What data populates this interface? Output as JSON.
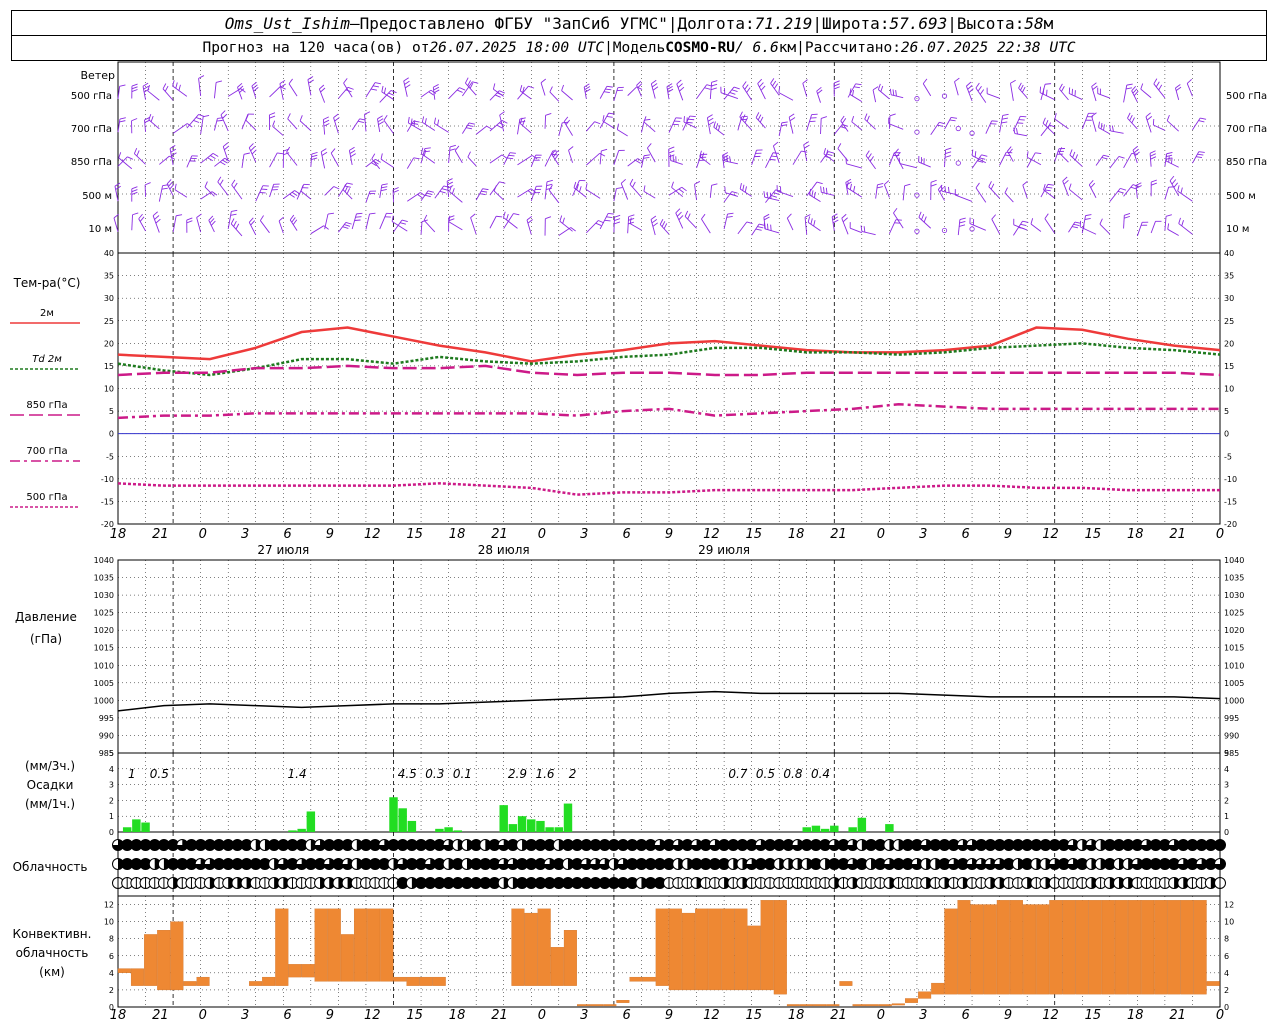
{
  "header": {
    "station": "Oms_Ust_Ishim",
    "dash": " – ",
    "provider": "Предоставлено ФГБУ \"ЗапСиб УГМС\"",
    "sep": " | ",
    "lon_label": "Долгота: ",
    "lon_value": "71.219",
    "lat_label": "Широта: ",
    "lat_value": "57.693",
    "alt_label": "Высота: ",
    "alt_value": "58",
    "alt_unit": "м",
    "forecast_label": "Прогноз на 120 часа(ов) от ",
    "forecast_start": "26.07.2025 18:00 UTC",
    "model_label": "Модель ",
    "model_name": "COSMO-RU",
    "model_res": " / 6.6",
    "model_res_unit": "км",
    "computed_label": "Рассчитано: ",
    "computed_value": "26.07.2025 22:38 UTC"
  },
  "panels": {
    "wind": {
      "title": "Ветер",
      "levels": [
        "500 гПа",
        "700 гПа",
        "850 гПа",
        "500 м",
        "10 м"
      ],
      "color": "#8a2be2"
    },
    "temperature": {
      "title": "Тем-ра(°С)",
      "legend": [
        {
          "label": "2м",
          "color": "#ee3a3a",
          "dash": ""
        },
        {
          "label": "Td 2м",
          "color": "#1e7a1e",
          "dash": "3,2"
        },
        {
          "label": "850 гПа",
          "color": "#cc1a88",
          "dash": "14,5"
        },
        {
          "label": "700 гПа",
          "color": "#cc1a88",
          "dash": "10,4,3,4"
        },
        {
          "label": "500 гПа",
          "color": "#cc1a88",
          "dash": "3,2"
        }
      ]
    },
    "pressure": {
      "title_1": "Давление",
      "title_2": "(гПа)"
    },
    "precip": {
      "unit_top": "(мм/3ч.)",
      "title": "Осадки",
      "unit_bottom": "(мм/1ч.)",
      "color": "#22dd22"
    },
    "cloud": {
      "title": "Облачность"
    },
    "convective": {
      "title_1": "Конвективн.",
      "title_2": "облачность",
      "title_3": "(км)",
      "color": "#ee8833"
    }
  },
  "time_axis": {
    "hour_labels": [
      "18",
      "21",
      "0",
      "3",
      "6",
      "9",
      "12",
      "15",
      "18",
      "21",
      "0",
      "3",
      "6",
      "9",
      "12",
      "15",
      "18",
      "21",
      "0",
      "3",
      "6",
      "9",
      "12",
      "15",
      "18",
      "21",
      "0"
    ],
    "date_labels": [
      {
        "label": "27 июля",
        "at_hour": 18
      },
      {
        "label": "28 июля",
        "at_hour": 42
      },
      {
        "label": "29 июля",
        "at_hour": 66
      }
    ]
  },
  "chart_data": [
    {
      "type": "line",
      "panel": "temperature",
      "x_hours": [
        0,
        3,
        6,
        9,
        12,
        15,
        18,
        21,
        24,
        27,
        30,
        33,
        36,
        39,
        42,
        45,
        48,
        51,
        54,
        57,
        60,
        63,
        66,
        69,
        72
      ],
      "ylim": [
        -20,
        40
      ],
      "yticks": [
        -20,
        -15,
        -10,
        -5,
        0,
        5,
        10,
        15,
        20,
        25,
        30,
        35,
        40
      ],
      "series": [
        {
          "name": "2м",
          "values": [
            17.5,
            17.0,
            16.5,
            19.0,
            22.5,
            23.5,
            21.5,
            19.5,
            18.0,
            16.0,
            17.5,
            18.5,
            20.0,
            20.5,
            19.5,
            18.5,
            18.0,
            18.0,
            18.5,
            19.5,
            23.5,
            23.0,
            21.0,
            19.5,
            18.5
          ]
        },
        {
          "name": "Td 2м",
          "values": [
            15.5,
            14.0,
            13.0,
            14.5,
            16.5,
            16.5,
            15.5,
            17.0,
            16.0,
            15.5,
            16.0,
            17.0,
            17.5,
            19.0,
            19.0,
            18.0,
            18.0,
            17.5,
            18.0,
            19.0,
            19.5,
            20.0,
            19.0,
            18.5,
            17.5
          ]
        },
        {
          "name": "850 гПа",
          "values": [
            13.0,
            13.5,
            13.5,
            14.5,
            14.5,
            15.0,
            14.5,
            14.5,
            15.0,
            13.5,
            13.0,
            13.5,
            13.5,
            13.0,
            13.0,
            13.5,
            13.5,
            13.5,
            13.5,
            13.5,
            13.5,
            13.5,
            13.5,
            13.5,
            13.0
          ]
        },
        {
          "name": "700 гПа",
          "values": [
            3.5,
            4.0,
            4.0,
            4.5,
            4.5,
            4.5,
            4.5,
            4.5,
            4.5,
            4.5,
            4.0,
            5.0,
            5.5,
            4.0,
            4.5,
            5.0,
            5.5,
            6.5,
            6.0,
            5.5,
            5.5,
            5.5,
            5.5,
            5.5,
            5.5
          ]
        },
        {
          "name": "500 гПа",
          "values": [
            -11.0,
            -11.5,
            -11.5,
            -11.5,
            -11.5,
            -11.5,
            -11.5,
            -11.0,
            -11.5,
            -12.0,
            -13.5,
            -13.0,
            -13.0,
            -12.5,
            -12.5,
            -12.5,
            -12.5,
            -12.0,
            -11.5,
            -11.5,
            -12.0,
            -12.0,
            -12.5,
            -12.5,
            -12.5
          ]
        }
      ],
      "zero_line_color": "#3333cc"
    },
    {
      "type": "line",
      "panel": "pressure",
      "x_hours": [
        0,
        3,
        6,
        9,
        12,
        15,
        18,
        21,
        24,
        27,
        30,
        33,
        36,
        39,
        42,
        45,
        48,
        51,
        54,
        57,
        60,
        63,
        66,
        69,
        72
      ],
      "ylim": [
        985,
        1040
      ],
      "yticks": [
        985,
        990,
        995,
        1000,
        1005,
        1010,
        1015,
        1020,
        1025,
        1030,
        1035,
        1040
      ],
      "series": [
        {
          "name": "",
          "values": [
            997.0,
            998.5,
            999.0,
            998.5,
            998.0,
            998.5,
            999.0,
            999.0,
            999.5,
            1000.0,
            1000.5,
            1001.0,
            1002.0,
            1002.5,
            1002.0,
            1002.0,
            1002.0,
            1002.0,
            1001.5,
            1001.0,
            1001.0,
            1001.0,
            1001.0,
            1001.0,
            1000.5
          ]
        }
      ]
    },
    {
      "type": "bar",
      "panel": "precipitation",
      "x_hours": [
        1,
        2,
        3,
        4,
        5,
        19,
        20,
        21,
        22,
        30,
        31,
        32,
        33,
        34,
        35,
        36,
        37,
        38,
        42,
        43,
        44,
        45,
        46,
        47,
        48,
        49,
        50,
        51,
        52,
        53,
        54,
        55,
        75,
        76,
        77,
        78,
        79,
        80,
        81,
        82,
        83,
        84
      ],
      "ylim": [
        0,
        5
      ],
      "yticks": [
        0,
        1,
        2,
        3,
        4,
        5
      ],
      "values": [
        0.3,
        0.8,
        0.6,
        0,
        0,
        0.1,
        0.2,
        1.3,
        0,
        2.2,
        1.5,
        0.7,
        0,
        0,
        0.2,
        0.3,
        0.1,
        0,
        1.7,
        0.5,
        1.0,
        0.8,
        0.7,
        0.3,
        0.3,
        1.8,
        0,
        0,
        0,
        0,
        0,
        0,
        0.3,
        0.4,
        0.2,
        0.4,
        0,
        0.3,
        0.9,
        0,
        0,
        0.5
      ],
      "labels": [
        {
          "hour": 1.5,
          "text": "1"
        },
        {
          "hour": 4.5,
          "text": "0.5"
        },
        {
          "hour": 19.5,
          "text": "1.4"
        },
        {
          "hour": 31.5,
          "text": "4.5"
        },
        {
          "hour": 34.5,
          "text": "0.3"
        },
        {
          "hour": 37.5,
          "text": "0.1"
        },
        {
          "hour": 43.5,
          "text": "2.9"
        },
        {
          "hour": 46.5,
          "text": "1.6"
        },
        {
          "hour": 49.5,
          "text": "2"
        },
        {
          "hour": 67.5,
          "text": "0.7"
        },
        {
          "hour": 70.5,
          "text": "0.5"
        },
        {
          "hour": 73.5,
          "text": "0.8"
        },
        {
          "hour": 76.5,
          "text": "0.4"
        }
      ]
    },
    {
      "type": "bar",
      "panel": "convective_cloud",
      "x_hours": [
        0,
        1,
        2,
        3,
        4,
        5,
        6,
        10,
        11,
        12,
        13,
        14,
        15,
        16,
        17,
        18,
        19,
        20,
        21,
        22,
        23,
        24,
        30,
        31,
        32,
        33,
        34,
        35,
        36,
        37,
        38,
        39,
        40,
        41,
        42,
        43,
        44,
        45,
        46,
        47,
        48,
        49,
        50,
        51,
        52,
        53,
        54,
        55,
        56,
        57,
        58,
        59,
        60,
        61,
        62,
        63,
        64,
        65,
        66,
        67,
        68,
        69,
        70,
        71,
        72,
        73,
        74,
        75,
        76,
        77,
        78,
        79,
        80,
        81,
        82,
        83,
        84
      ],
      "ylim": [
        0,
        13
      ],
      "yticks": [
        0,
        2,
        4,
        6,
        8,
        10,
        12
      ],
      "bottom": [
        4.0,
        2.5,
        2.5,
        2.0,
        2.0,
        2.5,
        2.5,
        2.5,
        2.5,
        2.5,
        3.5,
        3.5,
        3.0,
        3.0,
        3.0,
        3.0,
        3.0,
        3.0,
        3.0,
        2.5,
        2.5,
        2.5,
        2.5,
        2.5,
        2.5,
        2.5,
        2.5,
        0.3,
        0.3,
        0.3,
        0.5,
        3.0,
        3.0,
        2.5,
        2.0,
        2.0,
        2.0,
        2.0,
        2.0,
        2.0,
        2.0,
        2.0,
        1.5,
        0.3,
        0.3,
        0.3,
        0.3,
        2.5,
        0.3,
        0.3,
        0.3,
        0.3,
        0.5,
        1.0,
        1.5,
        1.5,
        1.5,
        1.5,
        1.5,
        1.5,
        1.5,
        1.5,
        1.5,
        1.5,
        1.5,
        1.5,
        1.5,
        1.5,
        1.5,
        1.5,
        1.5,
        1.5,
        1.5,
        1.5,
        1.5,
        2.5
      ],
      "top": [
        4.5,
        4.5,
        8.5,
        9.0,
        10.0,
        3.0,
        3.5,
        3.0,
        3.5,
        11.5,
        5.0,
        5.0,
        11.5,
        11.5,
        8.5,
        11.5,
        11.5,
        11.5,
        3.5,
        3.5,
        3.5,
        3.5,
        11.5,
        11.0,
        11.5,
        7.0,
        9.0,
        0.3,
        0.3,
        0.3,
        0.8,
        3.5,
        3.5,
        11.5,
        11.5,
        11.0,
        11.5,
        11.5,
        11.5,
        11.5,
        9.5,
        12.5,
        12.5,
        0.3,
        0.3,
        0.3,
        0.3,
        3.0,
        0.3,
        0.3,
        0.3,
        0.4,
        1.0,
        1.8,
        2.8,
        11.5,
        12.5,
        12.0,
        12.0,
        12.5,
        12.5,
        12.0,
        12.0,
        12.5,
        12.5,
        12.5,
        12.5,
        12.5,
        12.5,
        12.5,
        12.5,
        12.5,
        12.5,
        12.5,
        12.5,
        3.0
      ]
    }
  ]
}
